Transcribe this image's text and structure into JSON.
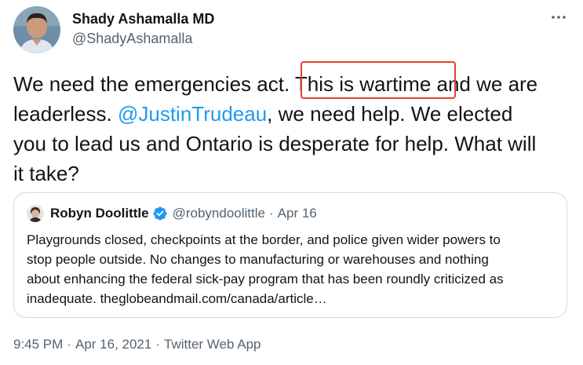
{
  "tweet": {
    "author": {
      "name": "Shady Ashamalla MD",
      "handle": "@ShadyAshamalla"
    },
    "text_lines": [
      {
        "before": "We need the emergencies act. This is wartime and we are",
        "mention": "",
        "after": ""
      },
      {
        "before": "leaderless. ",
        "mention": "@JustinTrudeau",
        "after": ", we need help. We elected"
      },
      {
        "before": "you to lead us and Ontario is desperate for help. What will",
        "mention": "",
        "after": ""
      },
      {
        "before": "it take?",
        "mention": "",
        "after": ""
      }
    ],
    "highlighted_phrase": "This is wartime",
    "highlight_color": "#e0442f",
    "more_icon": "more-horizontal-icon",
    "quoted": {
      "name": "Robyn Doolittle",
      "verified": true,
      "verified_icon": "verified-badge-icon",
      "handle": "@robyndoolittle",
      "separator": "·",
      "date": "Apr 16",
      "text_lines": [
        "Playgrounds closed, checkpoints at the border, and police given wider powers to",
        "stop people outside. No changes to manufacturing or warehouses and nothing",
        "about enhancing the federal sick-pay program that has been roundly criticized as",
        "inadequate. theglobeandmail.com/canada/article…"
      ]
    },
    "meta": {
      "time": "9:45 PM",
      "separator": "·",
      "date": "Apr 16, 2021",
      "source": "Twitter Web App"
    }
  },
  "colors": {
    "link": "#1d9bf0",
    "muted": "#536471",
    "text": "#0f1419",
    "border": "#cfd9de",
    "verified": "#1d9bf0"
  }
}
